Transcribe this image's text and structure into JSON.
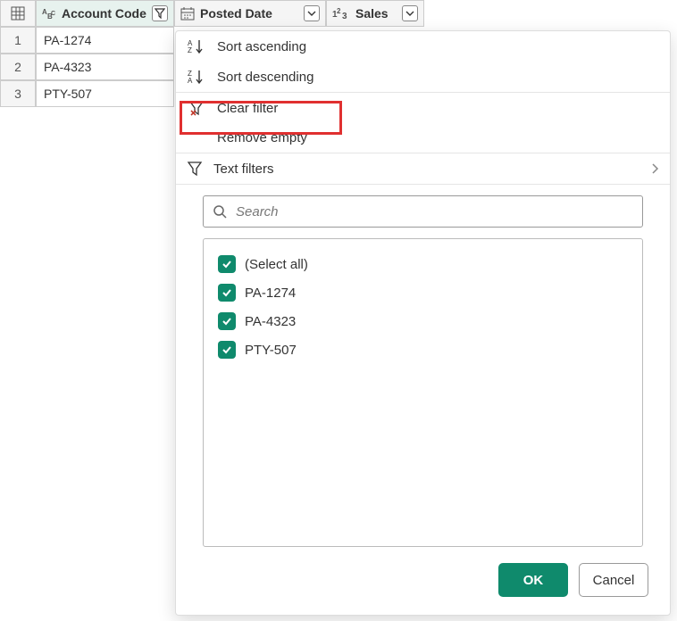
{
  "columns": {
    "c1": {
      "label": "Account Code"
    },
    "c2": {
      "label": "Posted Date"
    },
    "c3": {
      "label": "Sales"
    }
  },
  "rows": [
    {
      "num": "1",
      "code": "PA-1274"
    },
    {
      "num": "2",
      "code": "PA-4323"
    },
    {
      "num": "3",
      "code": "PTY-507"
    }
  ],
  "menu": {
    "sort_asc": "Sort ascending",
    "sort_desc": "Sort descending",
    "clear_filter": "Clear filter",
    "remove_empty": "Remove empty",
    "text_filters": "Text filters"
  },
  "search": {
    "placeholder": "Search"
  },
  "filter_items": [
    {
      "label": "(Select all)"
    },
    {
      "label": "PA-1274"
    },
    {
      "label": "PA-4323"
    },
    {
      "label": "PTY-507"
    }
  ],
  "buttons": {
    "ok": "OK",
    "cancel": "Cancel"
  }
}
